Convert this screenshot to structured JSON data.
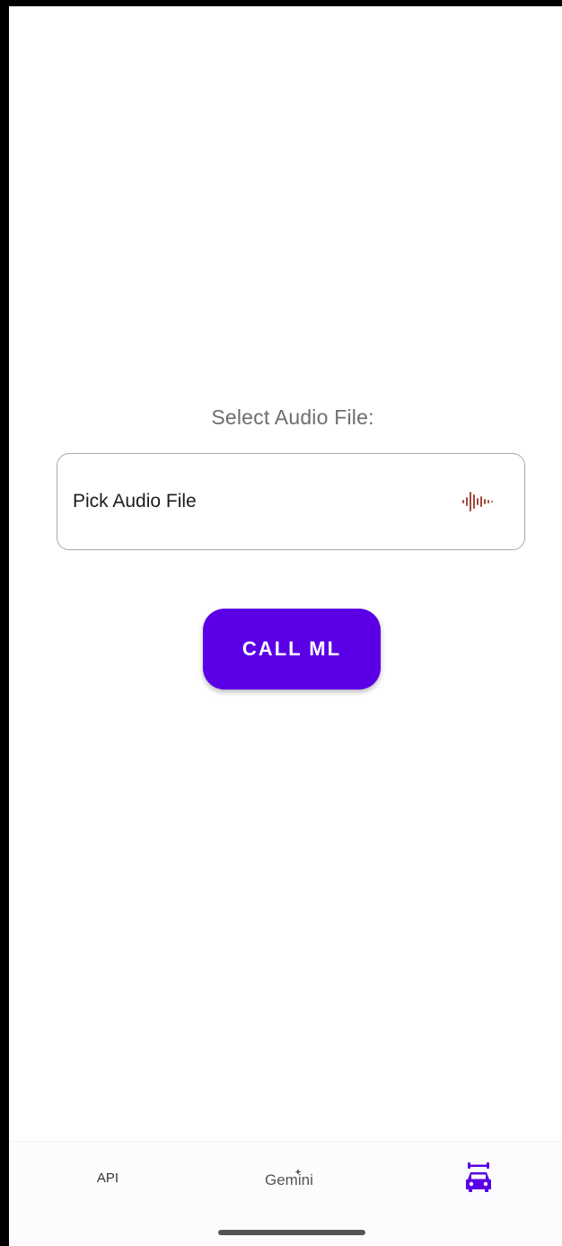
{
  "main": {
    "prompt_label": "Select Audio File:",
    "picker_label": "Pick Audio File",
    "picker_icon": "audio-waveform-icon",
    "call_button_label": "CALL ML"
  },
  "bottom_nav": {
    "items": [
      {
        "label": "API",
        "icon": null,
        "selected": false
      },
      {
        "label": "Gemini",
        "icon": "gemini-logo",
        "selected": false
      },
      {
        "label": "",
        "icon": "car-repair-icon",
        "selected": true
      }
    ]
  },
  "colors": {
    "accent": "#5b00e6",
    "waveform_icon": "#a3473a",
    "prompt_text": "#6e6e6e",
    "picker_border": "#a9a9a9"
  }
}
